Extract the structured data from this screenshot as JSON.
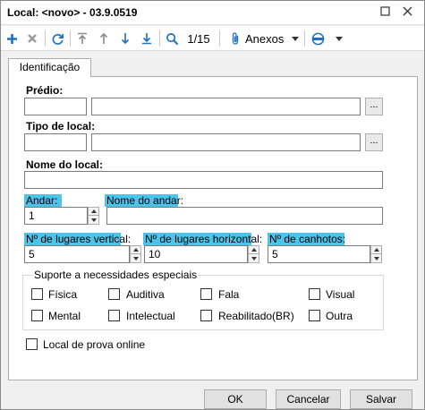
{
  "window": {
    "title": "Local: <novo> - 03.9.0519"
  },
  "toolbar": {
    "page_indicator": "1/15",
    "attachments_label": "Anexos"
  },
  "tabs": [
    {
      "label": "Identificação",
      "active": true
    }
  ],
  "form": {
    "building_label": "Prédio:",
    "building_code": "",
    "building_name": "",
    "location_type_label": "Tipo de local:",
    "location_type_code": "",
    "location_type_name": "",
    "location_name_label": "Nome do local:",
    "location_name": "",
    "floor_label": "Andar:",
    "floor_value": "1",
    "floor_name_label": "Nome do andar:",
    "floor_name": "",
    "vertical_places_label": "Nº de lugares vertical:",
    "vertical_places_value": "5",
    "horizontal_places_label": "Nº de lugares horizontal:",
    "horizontal_places_value": "10",
    "left_handed_label": "Nº de canhotos:",
    "left_handed_value": "5",
    "ellipsis_label": "..."
  },
  "special_needs": {
    "title": "Suporte a necessidades especiais",
    "options": [
      {
        "label": "Física",
        "checked": false
      },
      {
        "label": "Auditiva",
        "checked": false
      },
      {
        "label": "Fala",
        "checked": false
      },
      {
        "label": "Visual",
        "checked": false
      },
      {
        "label": "Mental",
        "checked": false
      },
      {
        "label": "Intelectual",
        "checked": false
      },
      {
        "label": "Reabilitado(BR)",
        "checked": false
      },
      {
        "label": "Outra",
        "checked": false
      }
    ]
  },
  "online_exam": {
    "label": "Local de prova online",
    "checked": false
  },
  "buttons": {
    "ok": "OK",
    "cancel": "Cancelar",
    "save": "Salvar"
  },
  "colors": {
    "highlight": "#4cc3ea",
    "icon_blue": "#1e6fc2"
  }
}
